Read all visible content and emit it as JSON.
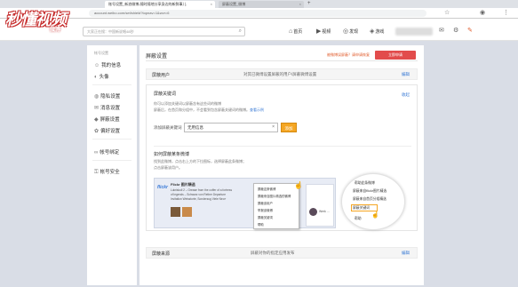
{
  "browser": {
    "tabs": [
      {
        "label": "账号设置_新浪微博-随时随地分享身边的新鲜事儿",
        "active": true
      },
      {
        "label": "屏蔽设置_微博",
        "active": false
      }
    ],
    "new_tab": "+",
    "url": "account.weibo.com/set/shield?topnav=1&wvr=6",
    "icons": [
      "back-icon",
      "star-icon",
      "menu-icon"
    ]
  },
  "header": {
    "logo_text": "秒懂视频",
    "logo_sub": "微博",
    "search_placeholder": "大家正在搜：中国新说唱48秒",
    "nav": [
      {
        "icon": "home-icon",
        "label": "首页"
      },
      {
        "icon": "video-icon",
        "label": "视频"
      },
      {
        "icon": "discover-icon",
        "label": "发现"
      },
      {
        "icon": "game-icon",
        "label": "游戏"
      }
    ]
  },
  "sidebar": {
    "section_title": "帐号设置",
    "items": [
      {
        "icon": "user-icon",
        "label": "我的信息"
      },
      {
        "icon": "avatar-icon",
        "label": "头像"
      },
      {
        "icon": "privacy-icon",
        "label": "隐私设置"
      },
      {
        "icon": "message-icon",
        "label": "消息设置"
      },
      {
        "icon": "shield-icon",
        "label": "屏蔽设置"
      },
      {
        "icon": "preference-icon",
        "label": "偏好设置"
      },
      {
        "icon": "link-icon",
        "label": "帐号绑定"
      },
      {
        "icon": "lock-icon",
        "label": "帐号安全"
      }
    ]
  },
  "main": {
    "title": "屏蔽设置",
    "report_link": "被微博误屏蔽？请申请恢复",
    "recover_button": "立即申请",
    "row_user": {
      "label": "屏蔽用户",
      "desc": "对其已微博设置屏蔽的用户/屏蔽微博设置",
      "link": "编辑"
    },
    "panel": {
      "title": "屏蔽关键词",
      "collapse_link": "收起",
      "desc_line1": "你可以添加关键词以屏蔽含有这些词的微博",
      "desc_line2": "屏蔽后，在首页和分组中，不会看到包含屏蔽关键词的微博。",
      "desc_link": "查看示例",
      "kw_label": "添加屏蔽关键词",
      "kw_value": "无用信息",
      "kw_clear": "×",
      "kw_add": "添加",
      "section2_title": "如何屏蔽某条微博",
      "section2_line1": "找到此微博，点击右上方的下拉图标，选择屏蔽此条微博；",
      "section2_line2": "点击屏蔽该用户。"
    },
    "illustration": {
      "logo": "flickr",
      "name": "Flickr 图片精选",
      "lines": [
        "Lukriskuli 2 – Grease from the coffer of a fortress",
        "of legends – Schwarz von Rether Departure",
        "Invitation Weisstorte, Sonderzug Viele Neo»"
      ],
      "feed_name": "Werk …",
      "menu": [
        "屏蔽这条微博",
        "屏蔽来自图片精选的微博",
        "屏蔽该用户",
        "举报该微博",
        "屏蔽关键词",
        "帮助"
      ],
      "magnifier": [
        "帮助此条微博",
        "屏蔽来自flickr图片精选",
        "屏蔽来自首页分组精选",
        "屏蔽关键词",
        "帮助"
      ]
    },
    "bottom_row": {
      "label": "屏蔽来源",
      "desc": "屏蔽对你的指定应用发布",
      "link": "编辑"
    }
  },
  "colors": {
    "brand_red": "#e24c4c",
    "link_blue": "#3a7bd5",
    "add_orange": "#f5a623"
  }
}
